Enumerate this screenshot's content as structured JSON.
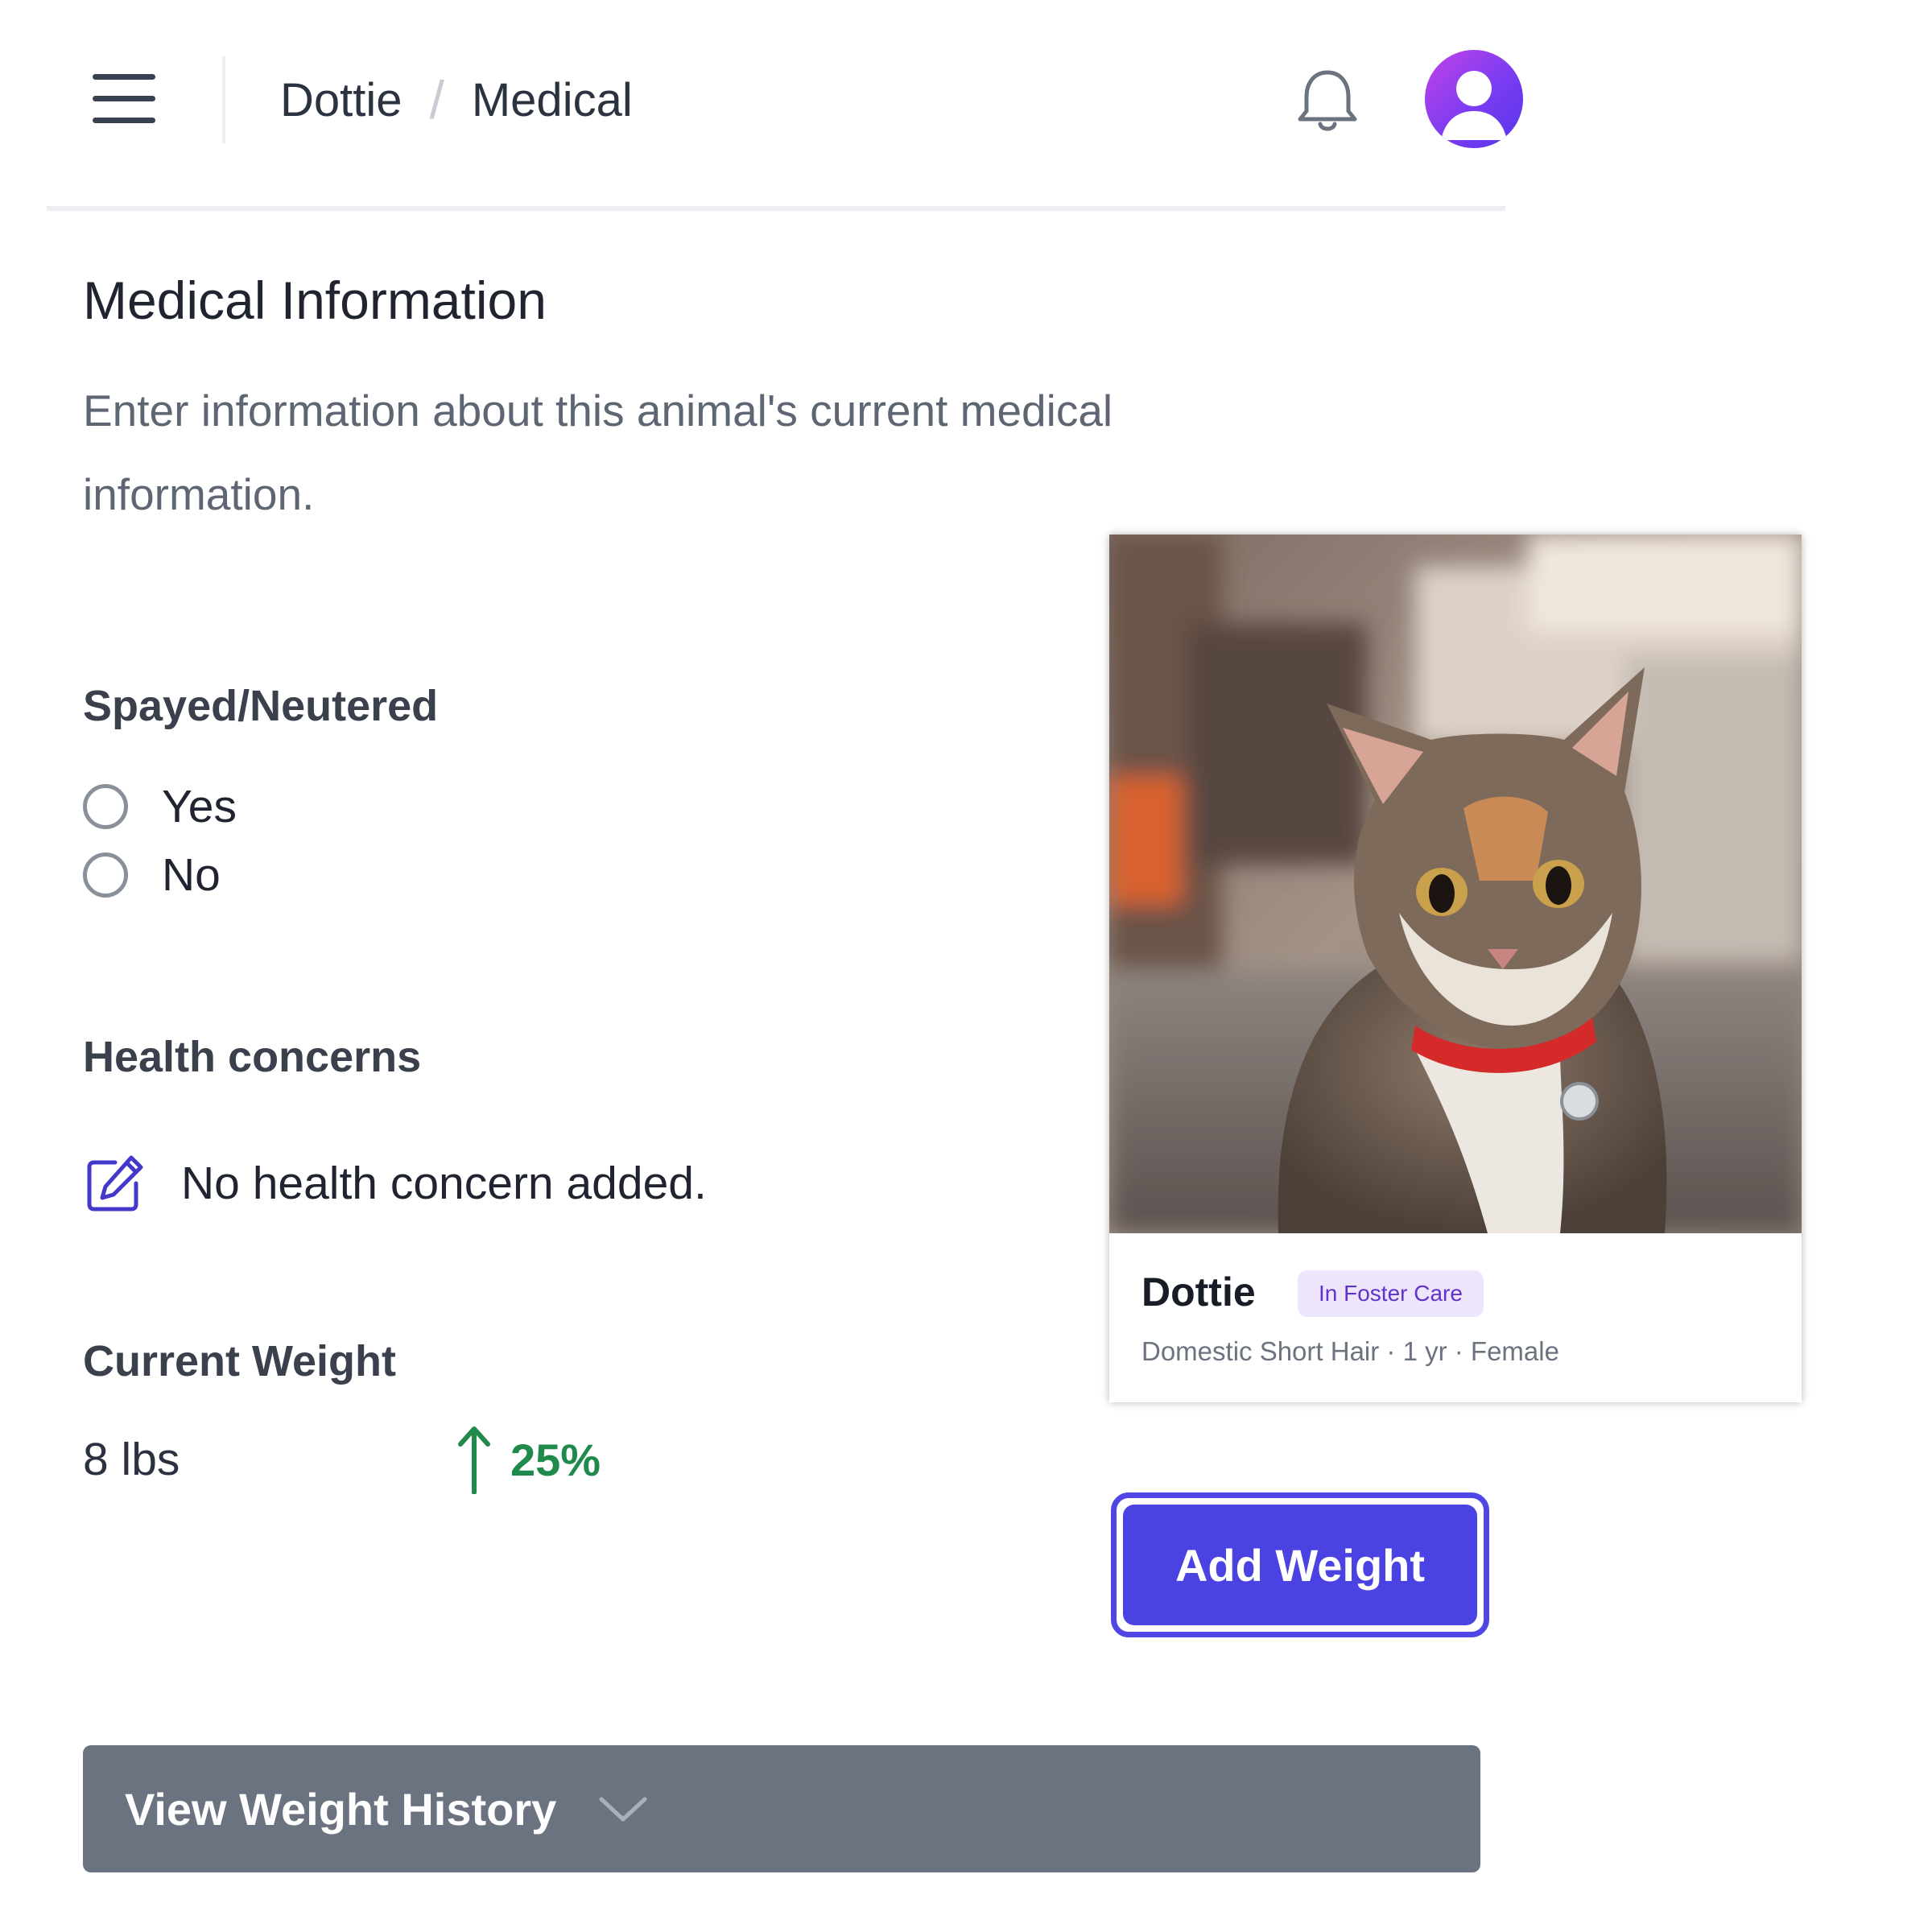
{
  "header": {
    "breadcrumb": [
      {
        "label": "Dottie"
      },
      {
        "label": "Medical"
      }
    ],
    "separator": "/",
    "icons": {
      "menu": "hamburger-menu-icon",
      "notifications": "bell-icon",
      "profile": "user-avatar-icon"
    }
  },
  "main": {
    "title": "Medical Information",
    "description": "Enter information about this animal's current medical information.",
    "spayed_neutered": {
      "label": "Spayed/Neutered",
      "options": [
        {
          "label": "Yes",
          "selected": false
        },
        {
          "label": "No",
          "selected": false
        }
      ]
    },
    "health_concerns": {
      "label": "Health concerns",
      "empty_text": "No health concern added.",
      "icon": "edit-icon"
    },
    "current_weight": {
      "label": "Current Weight",
      "value": "8 lbs",
      "change": "25%",
      "change_direction": "up",
      "change_color": "#1f8a4c"
    }
  },
  "card": {
    "name": "Dottie",
    "status": "In Foster Care",
    "details": "Domestic Short Hair · 1 yr · Female",
    "photo": "calico-tabby-kitten-with-red-collar"
  },
  "actions": {
    "add_weight": "Add Weight",
    "view_history": "View Weight History"
  },
  "colors": {
    "primary": "#4a43e2",
    "secondary_button": "#6b7280",
    "badge_bg": "#ede5fb",
    "badge_text": "#6233c9"
  }
}
